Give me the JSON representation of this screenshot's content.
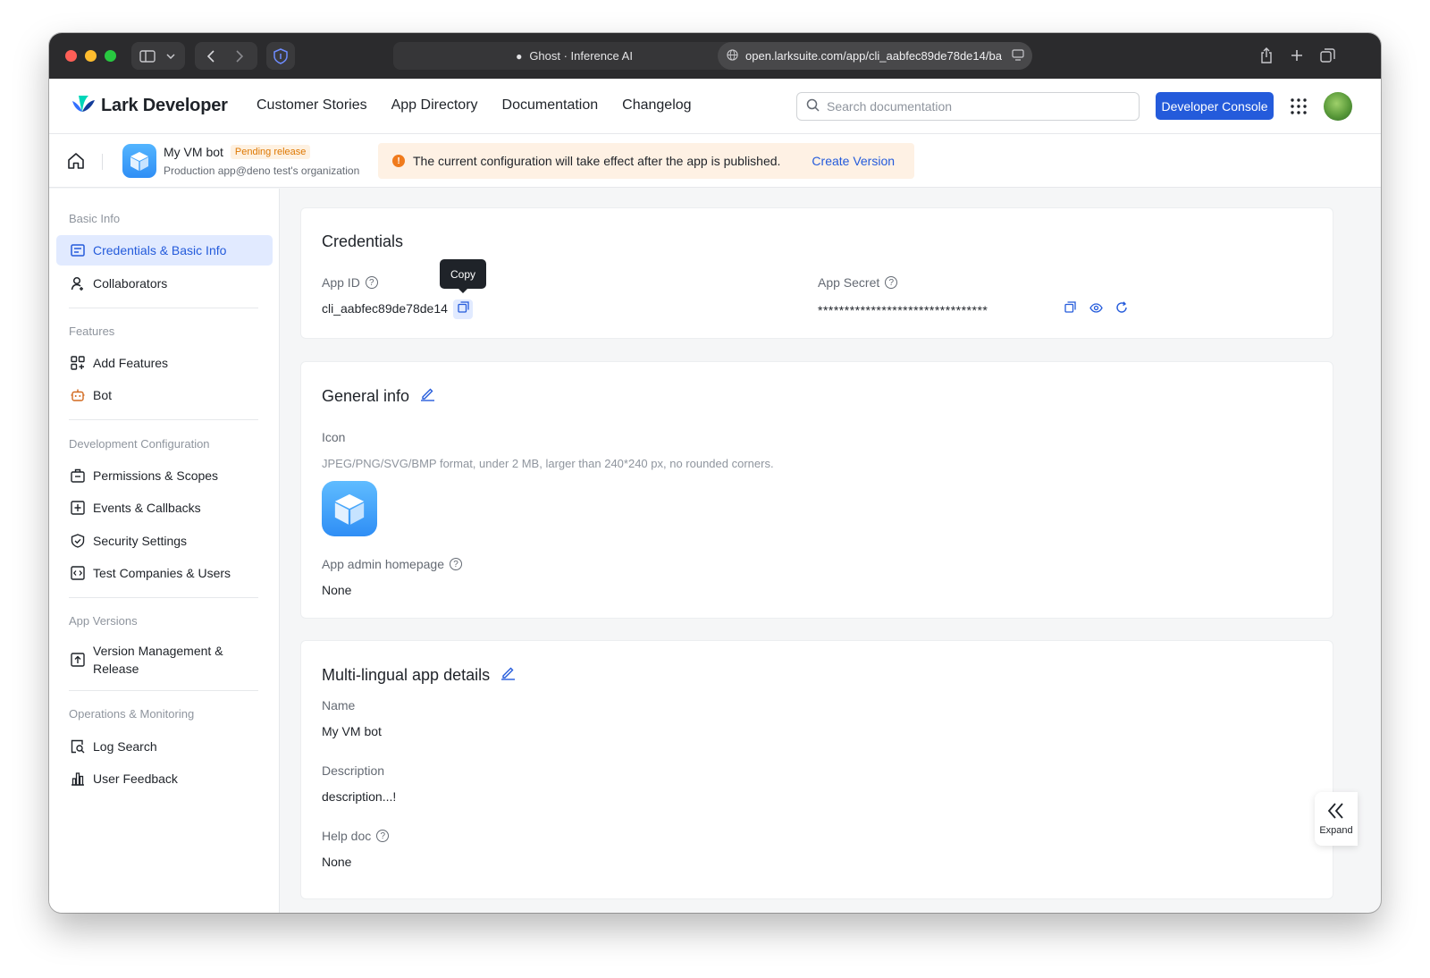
{
  "browser": {
    "tab_title": "Ghost · Inference AI",
    "url": "open.larksuite.com/app/cli_aabfec89de78de14/ba"
  },
  "topnav": {
    "brand": "Lark Developer",
    "links": [
      "Customer Stories",
      "App Directory",
      "Documentation",
      "Changelog"
    ],
    "search_placeholder": "Search documentation",
    "console_button": "Developer Console"
  },
  "app": {
    "name": "My VM bot",
    "status_badge": "Pending release",
    "subtitle": "Production app@deno test's organization",
    "notice_text": "The current configuration will take effect after the app is published.",
    "notice_link": "Create Version"
  },
  "sidebar": {
    "groups": [
      {
        "title": "Basic Info",
        "items": [
          {
            "label": "Credentials & Basic Info",
            "icon": "credentials-icon",
            "active": true
          },
          {
            "label": "Collaborators",
            "icon": "user-icon"
          }
        ]
      },
      {
        "title": "Features",
        "items": [
          {
            "label": "Add Features",
            "icon": "add-features-icon"
          },
          {
            "label": "Bot",
            "icon": "bot-icon"
          }
        ]
      },
      {
        "title": "Development Configuration",
        "items": [
          {
            "label": "Permissions & Scopes",
            "icon": "briefcase-icon"
          },
          {
            "label": "Events & Callbacks",
            "icon": "events-icon"
          },
          {
            "label": "Security Settings",
            "icon": "shield-icon"
          },
          {
            "label": "Test Companies & Users",
            "icon": "code-icon"
          }
        ]
      },
      {
        "title": "App Versions",
        "items": [
          {
            "label": "Version Management & Release",
            "icon": "upload-icon"
          }
        ]
      },
      {
        "title": "Operations & Monitoring",
        "items": [
          {
            "label": "Log Search",
            "icon": "log-search-icon"
          },
          {
            "label": "User Feedback",
            "icon": "bar-chart-icon"
          }
        ]
      }
    ]
  },
  "credentials": {
    "title": "Credentials",
    "app_id_label": "App ID",
    "app_id_value": "cli_aabfec89de78de14",
    "copy_tooltip": "Copy",
    "app_secret_label": "App Secret",
    "app_secret_value": "********************************"
  },
  "general": {
    "title": "General info",
    "icon_label": "Icon",
    "icon_hint": "JPEG/PNG/SVG/BMP format, under 2 MB, larger than 240*240 px, no rounded corners.",
    "homepage_label": "App admin homepage",
    "homepage_value": "None"
  },
  "multilingual": {
    "title": "Multi-lingual app details",
    "name_label": "Name",
    "name_value": "My VM bot",
    "description_label": "Description",
    "description_value": "description...!",
    "help_label": "Help doc",
    "help_value": "None"
  },
  "expand_label": "Expand",
  "colors": {
    "accent": "#245bdb",
    "active_bg": "#e1eaff",
    "badge_text": "#de7802",
    "notice_bg": "#fef1e4"
  }
}
